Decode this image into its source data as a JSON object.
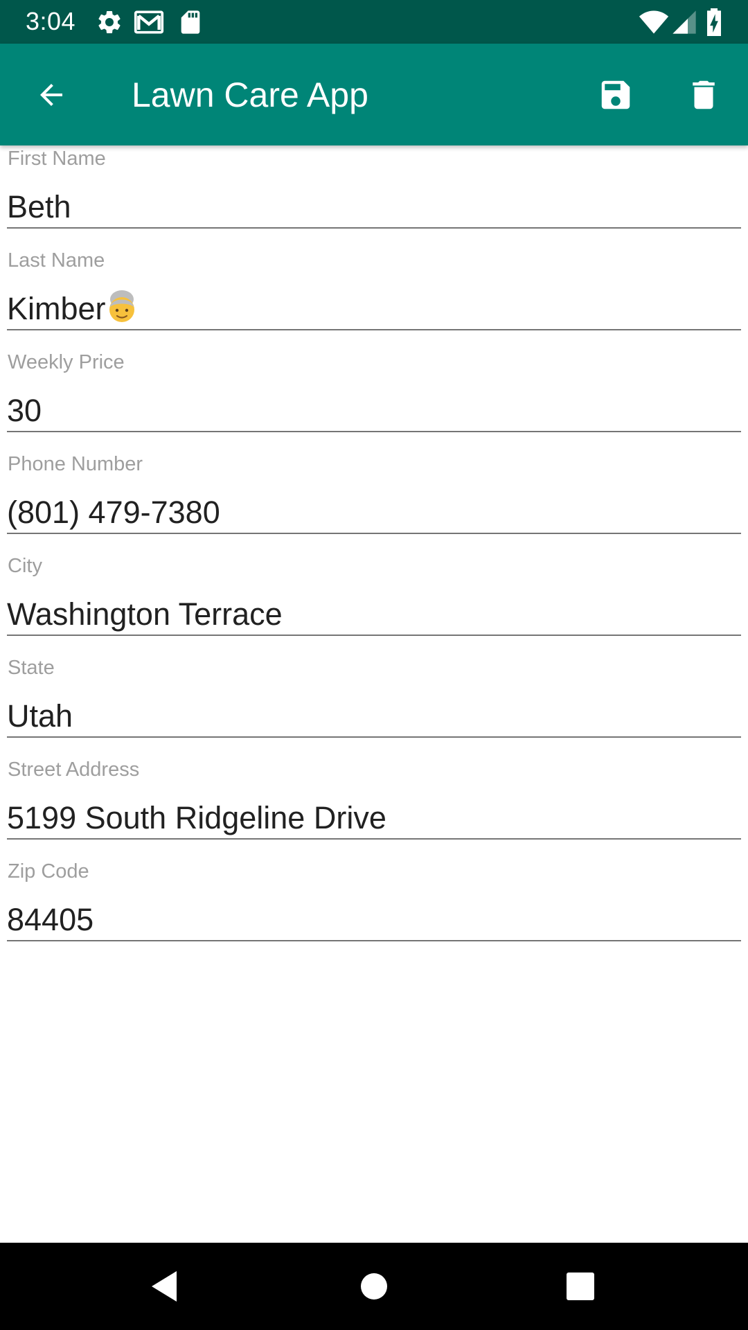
{
  "status_bar": {
    "time": "3:04",
    "icons": [
      "gear-icon",
      "gmail-icon",
      "sd-card-icon",
      "wifi-icon",
      "signal-icon",
      "battery-charging-icon"
    ]
  },
  "app_bar": {
    "title": "Lawn Care App",
    "back_icon": "arrow-back-icon",
    "save_icon": "save-icon",
    "delete_icon": "delete-icon",
    "color": "#008577",
    "status_color": "#00574b"
  },
  "form": {
    "fields": [
      {
        "label": "First Name",
        "value": "Beth"
      },
      {
        "label": "Last Name",
        "value": "Kimber",
        "suffix_emoji": "older-woman-emoji"
      },
      {
        "label": "Weekly Price",
        "value": "30"
      },
      {
        "label": "Phone Number",
        "value": "(801) 479-7380"
      },
      {
        "label": "City",
        "value": "Washington Terrace"
      },
      {
        "label": "State",
        "value": "Utah"
      },
      {
        "label": "Street Address",
        "value": "5199 South Ridgeline Drive"
      },
      {
        "label": "Zip Code",
        "value": "84405"
      }
    ]
  },
  "nav_bar": {
    "buttons": [
      "back-triangle-icon",
      "home-circle-icon",
      "recents-square-icon"
    ]
  }
}
